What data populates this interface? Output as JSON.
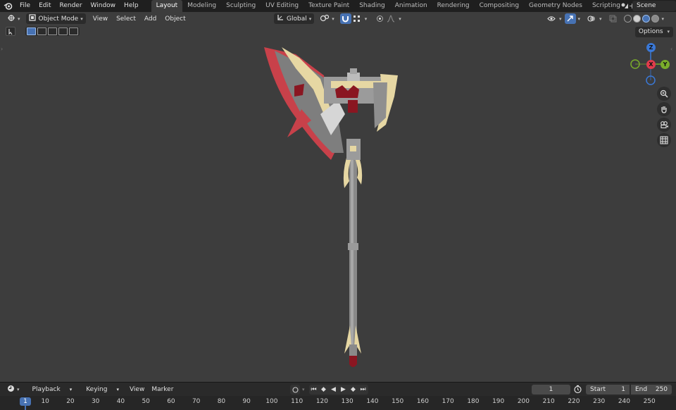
{
  "topbar": {
    "menus": [
      "File",
      "Edit",
      "Render",
      "Window",
      "Help"
    ],
    "workspaces": [
      "Layout",
      "Modeling",
      "Sculpting",
      "UV Editing",
      "Texture Paint",
      "Shading",
      "Animation",
      "Rendering",
      "Compositing",
      "Geometry Nodes",
      "Scripting"
    ],
    "active_workspace": "Layout",
    "add_tab": "+",
    "scene": "Scene"
  },
  "viewport_header": {
    "mode": "Object Mode",
    "menus": [
      "View",
      "Select",
      "Add",
      "Object"
    ],
    "transform_orientation": "Global",
    "options_label": "Options"
  },
  "gizmo": {
    "x_label": "X",
    "y_label": "Y",
    "z_label": "Z",
    "x_color": "#e23b4c",
    "y_color": "#7aad2b",
    "z_color": "#3a78d6"
  },
  "timeline": {
    "menus": [
      "Playback",
      "Keying",
      "View",
      "Marker"
    ],
    "current_frame": "1",
    "start_label": "Start",
    "start_value": "1",
    "end_label": "End",
    "end_value": "250",
    "ruler_ticks": [
      "10",
      "20",
      "30",
      "40",
      "50",
      "60",
      "70",
      "80",
      "90",
      "100",
      "110",
      "120",
      "130",
      "140",
      "150",
      "160",
      "170",
      "180",
      "190",
      "200",
      "210",
      "220",
      "230",
      "240",
      "250"
    ],
    "ruler_current": "1"
  },
  "colors": {
    "accent": "#4772b3",
    "viewport_bg": "#3d3d3d",
    "axe_red": "#c8414a",
    "axe_gold": "#e6d7a3",
    "axe_grey": "#8a8a8a",
    "axe_dark_red": "#8a1621"
  }
}
